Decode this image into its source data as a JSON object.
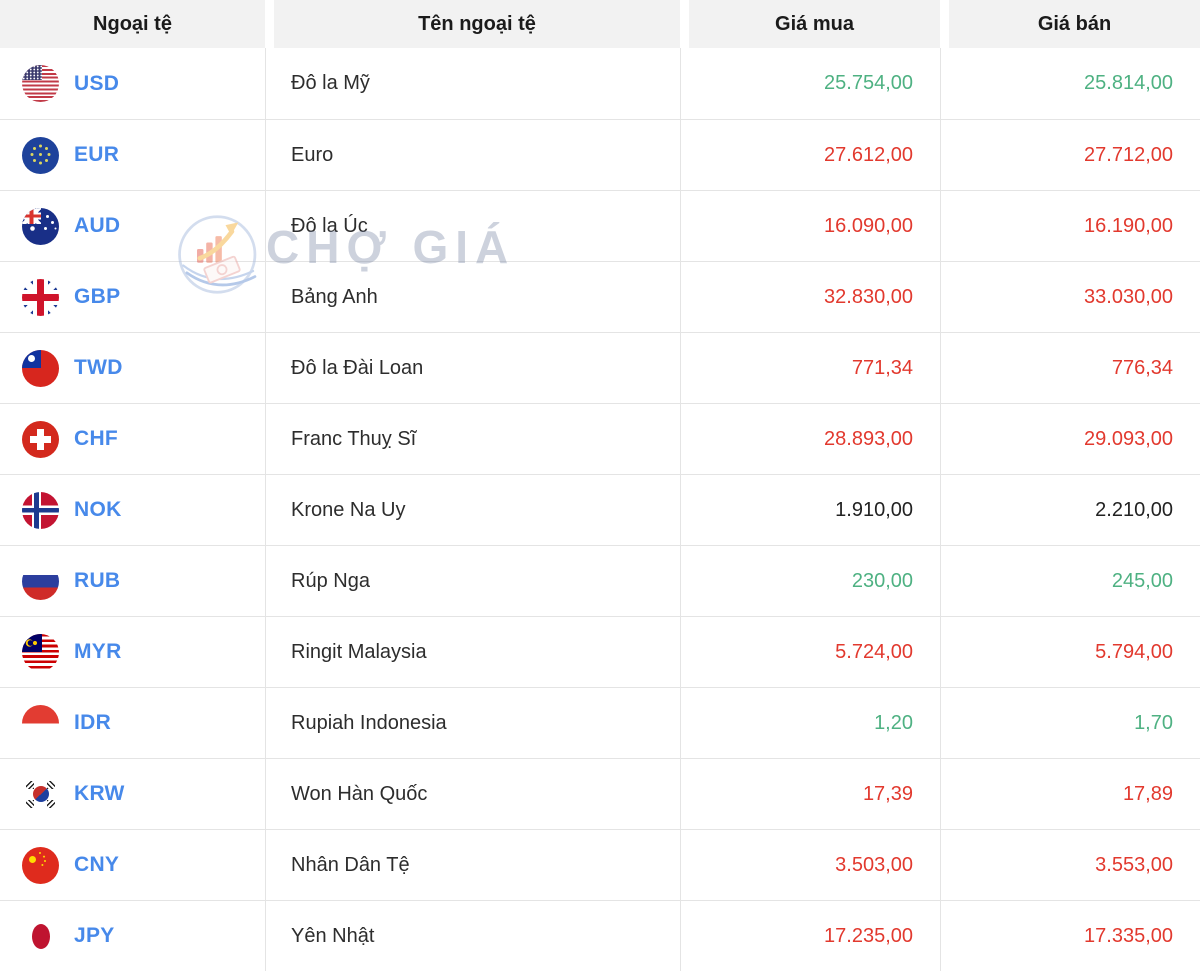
{
  "table": {
    "columns": [
      "Ngoại tệ",
      "Tên ngoại tệ",
      "Giá mua",
      "Giá bán"
    ],
    "rows": [
      {
        "code": "USD",
        "flag_icon": "usd-flag-icon",
        "name": "Đô la Mỹ",
        "buy": "25.754,00",
        "sell": "25.814,00",
        "trend": "up"
      },
      {
        "code": "EUR",
        "flag_icon": "eur-flag-icon",
        "name": "Euro",
        "buy": "27.612,00",
        "sell": "27.712,00",
        "trend": "down"
      },
      {
        "code": "AUD",
        "flag_icon": "aud-flag-icon",
        "name": "Đô la Úc",
        "buy": "16.090,00",
        "sell": "16.190,00",
        "trend": "down"
      },
      {
        "code": "GBP",
        "flag_icon": "gbp-flag-icon",
        "name": "Bảng Anh",
        "buy": "32.830,00",
        "sell": "33.030,00",
        "trend": "down"
      },
      {
        "code": "TWD",
        "flag_icon": "twd-flag-icon",
        "name": "Đô la Đài Loan",
        "buy": "771,34",
        "sell": "776,34",
        "trend": "down"
      },
      {
        "code": "CHF",
        "flag_icon": "chf-flag-icon",
        "name": "Franc Thuỵ Sĩ",
        "buy": "28.893,00",
        "sell": "29.093,00",
        "trend": "down"
      },
      {
        "code": "NOK",
        "flag_icon": "nok-flag-icon",
        "name": "Krone Na Uy",
        "buy": "1.910,00",
        "sell": "2.210,00",
        "trend": "neutral"
      },
      {
        "code": "RUB",
        "flag_icon": "rub-flag-icon",
        "name": "Rúp Nga",
        "buy": "230,00",
        "sell": "245,00",
        "trend": "up"
      },
      {
        "code": "MYR",
        "flag_icon": "myr-flag-icon",
        "name": "Ringit Malaysia",
        "buy": "5.724,00",
        "sell": "5.794,00",
        "trend": "down"
      },
      {
        "code": "IDR",
        "flag_icon": "idr-flag-icon",
        "name": "Rupiah Indonesia",
        "buy": "1,20",
        "sell": "1,70",
        "trend": "up"
      },
      {
        "code": "KRW",
        "flag_icon": "krw-flag-icon",
        "name": "Won Hàn Quốc",
        "buy": "17,39",
        "sell": "17,89",
        "trend": "down"
      },
      {
        "code": "CNY",
        "flag_icon": "cny-flag-icon",
        "name": "Nhân Dân Tệ",
        "buy": "3.503,00",
        "sell": "3.553,00",
        "trend": "down"
      },
      {
        "code": "JPY",
        "flag_icon": "jpy-flag-icon",
        "name": "Yên Nhật",
        "buy": "17.235,00",
        "sell": "17.335,00",
        "trend": "down"
      }
    ]
  },
  "watermark": {
    "text": "CHỢ GIÁ",
    "logo_icon": "cho-gia-logo-icon"
  },
  "colors": {
    "price_up": "#4eb182",
    "price_down": "#e2392e",
    "price_neutral": "#222222",
    "currency_code": "#4789ea",
    "header_bg": "#f2f2f2"
  }
}
